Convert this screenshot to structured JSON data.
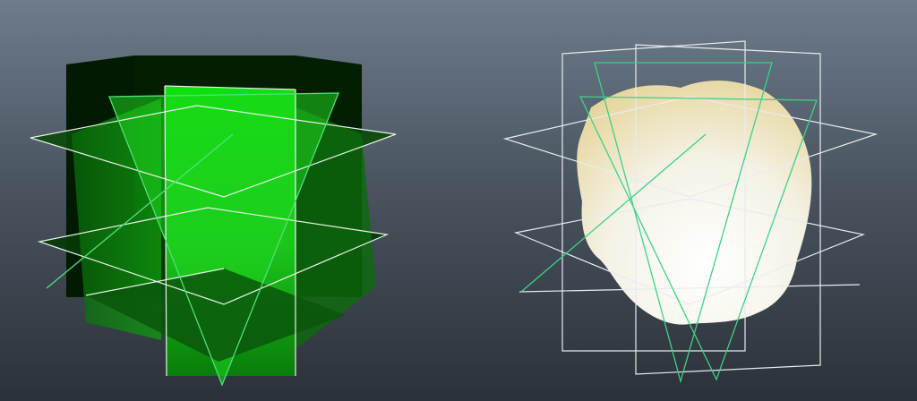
{
  "viewport": {
    "background_top": "#6e7c8b",
    "background_bottom": "#2b3138"
  },
  "scenes": {
    "left": {
      "label": "",
      "plane_fill_dark": "#003300",
      "plane_fill_bright": "#19ff19",
      "outline_color": "#e8f2e8",
      "selected_outline_color": "#4fe07a"
    },
    "right": {
      "label": "",
      "mesh_fill_light": "#fbf7ea",
      "mesh_fill_warm": "#ecdfa8",
      "outline_color": "#e8ecef",
      "selected_outline_color": "#3fd08a"
    }
  }
}
